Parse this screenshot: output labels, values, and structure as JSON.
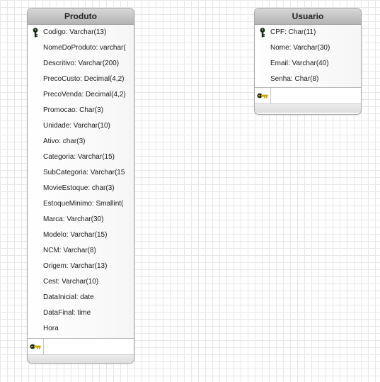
{
  "entities": {
    "produto": {
      "title": "Produto",
      "attributes": [
        {
          "text": "Codigo: Varchar(13)",
          "pk": true
        },
        {
          "text": "NomeDoProduto: varchar(",
          "pk": false
        },
        {
          "text": "Descritivo: Varchar(200)",
          "pk": false
        },
        {
          "text": "PrecoCusto: Decimal(4,2)",
          "pk": false
        },
        {
          "text": "PrecoVenda: Decimal(4,2)",
          "pk": false
        },
        {
          "text": "Promocao: Char(3)",
          "pk": false
        },
        {
          "text": "Unidade: Varchar(10)",
          "pk": false
        },
        {
          "text": "Ativo: char(3)",
          "pk": false
        },
        {
          "text": "Categoria: Varchar(15)",
          "pk": false
        },
        {
          "text": "SubCategoria: Varchar(15",
          "pk": false
        },
        {
          "text": "MovieEstoque: char(3)",
          "pk": false
        },
        {
          "text": "EstoqueMinimo: Smallint(",
          "pk": false
        },
        {
          "text": "Marca: Varchar(30)",
          "pk": false
        },
        {
          "text": "Modelo: Varchar(15)",
          "pk": false
        },
        {
          "text": "NCM: Varchar(8)",
          "pk": false
        },
        {
          "text": "Origem: Varchar(13)",
          "pk": false
        },
        {
          "text": "Cest: Varchar(10)",
          "pk": false
        },
        {
          "text": "DataInicial: date",
          "pk": false
        },
        {
          "text": "DataFinal: time",
          "pk": false
        },
        {
          "text": "Hora",
          "pk": false
        }
      ]
    },
    "usuario": {
      "title": "Usuario",
      "attributes": [
        {
          "text": "CPF: Char(11)",
          "pk": true
        },
        {
          "text": "Nome: Varchar(30)",
          "pk": false
        },
        {
          "text": "Email: Varchar(40)",
          "pk": false
        },
        {
          "text": "Senha: Char(8)",
          "pk": false
        }
      ]
    }
  },
  "icons": {
    "primary_key": "primary-key-icon",
    "foreign_key_section": "key-icon"
  },
  "colors": {
    "header_top": "#d8d8d8",
    "header_bottom": "#b4b4b4",
    "border": "#a8a8a8",
    "key_dark": "#1a2a1a",
    "key_gold": "#c8a800",
    "grid": "#e8e8e8"
  }
}
